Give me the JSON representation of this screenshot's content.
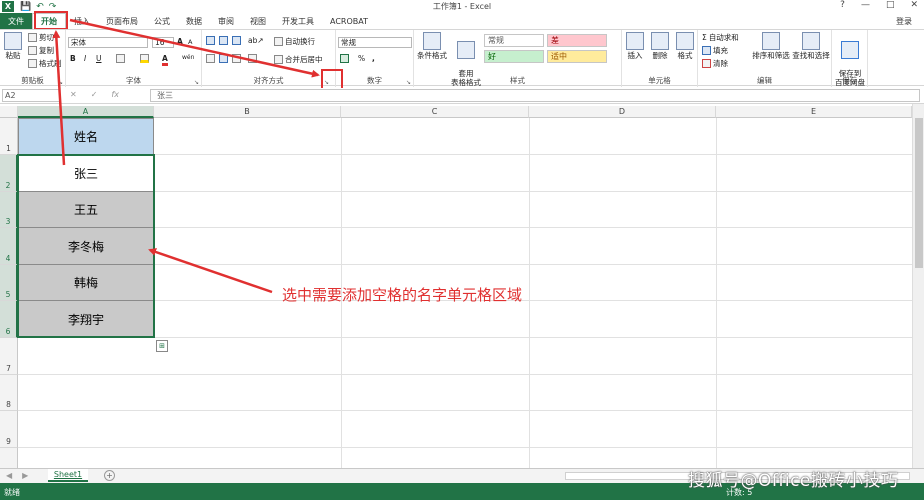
{
  "window": {
    "title": "工作簿1 - Excel",
    "help": "?",
    "min": "—",
    "max": "□",
    "close": "✕"
  },
  "qat": {
    "logo": "X",
    "save": "💾",
    "undo": "↶",
    "redo": "↷"
  },
  "tabs": [
    {
      "label": "文件"
    },
    {
      "label": "开始"
    },
    {
      "label": "插入"
    },
    {
      "label": "页面布局"
    },
    {
      "label": "公式"
    },
    {
      "label": "数据"
    },
    {
      "label": "审阅"
    },
    {
      "label": "视图"
    },
    {
      "label": "开发工具"
    },
    {
      "label": "ACROBAT"
    }
  ],
  "login": "登录",
  "ribbon": {
    "clipboard": {
      "label": "剪贴板",
      "paste": "粘贴",
      "cut": "剪切",
      "copy": "复制",
      "format_painter": "格式刷"
    },
    "font": {
      "label": "字体",
      "font_name": "宋体",
      "font_size": "16",
      "bold": "B",
      "italic": "I",
      "underline": "U",
      "grow": "A",
      "shrink": "A",
      "wen": "wén"
    },
    "alignment": {
      "label": "对齐方式",
      "wrap": "自动换行",
      "merge": "合并后居中"
    },
    "number": {
      "label": "数字",
      "format": "常规",
      "percent": "%",
      "comma": ","
    },
    "styles": {
      "label": "样式",
      "conditional": "条件格式",
      "table": "套用\n表格格式",
      "normal": "常规",
      "bad": "差",
      "good": "好",
      "neutral": "适中"
    },
    "cells": {
      "label": "单元格",
      "insert": "插入",
      "delete": "删除",
      "format": "格式"
    },
    "editing": {
      "label": "编辑",
      "autosum": "自动求和",
      "fill": "填充",
      "clear": "清除",
      "sort": "排序和筛选",
      "find": "查找和选择"
    },
    "save": {
      "label": "保存",
      "save_cloud": "保存到\n百度网盘"
    }
  },
  "formula_bar": {
    "name_box": "A2",
    "fx": "fx",
    "value": "张三"
  },
  "columns": [
    "A",
    "B",
    "C",
    "D",
    "E"
  ],
  "rows": [
    "1",
    "2",
    "3",
    "4",
    "5",
    "6",
    "7",
    "8",
    "9"
  ],
  "cells": {
    "header": "姓名",
    "names": [
      "张三",
      "王五",
      "李冬梅",
      "韩梅",
      "李翔宇"
    ]
  },
  "annotation": "选中需要添加空格的名字单元格区域",
  "sheet_tab": "Sheet1",
  "status": {
    "ready": "就绪",
    "right": "计数: 5"
  },
  "watermark": "搜狐号@Office搬砖小技巧",
  "colors": {
    "excel_green": "#217346",
    "header_fill": "#bdd7ee",
    "gray_fill": "#c9c9c9",
    "annotation_red": "#e03030"
  }
}
